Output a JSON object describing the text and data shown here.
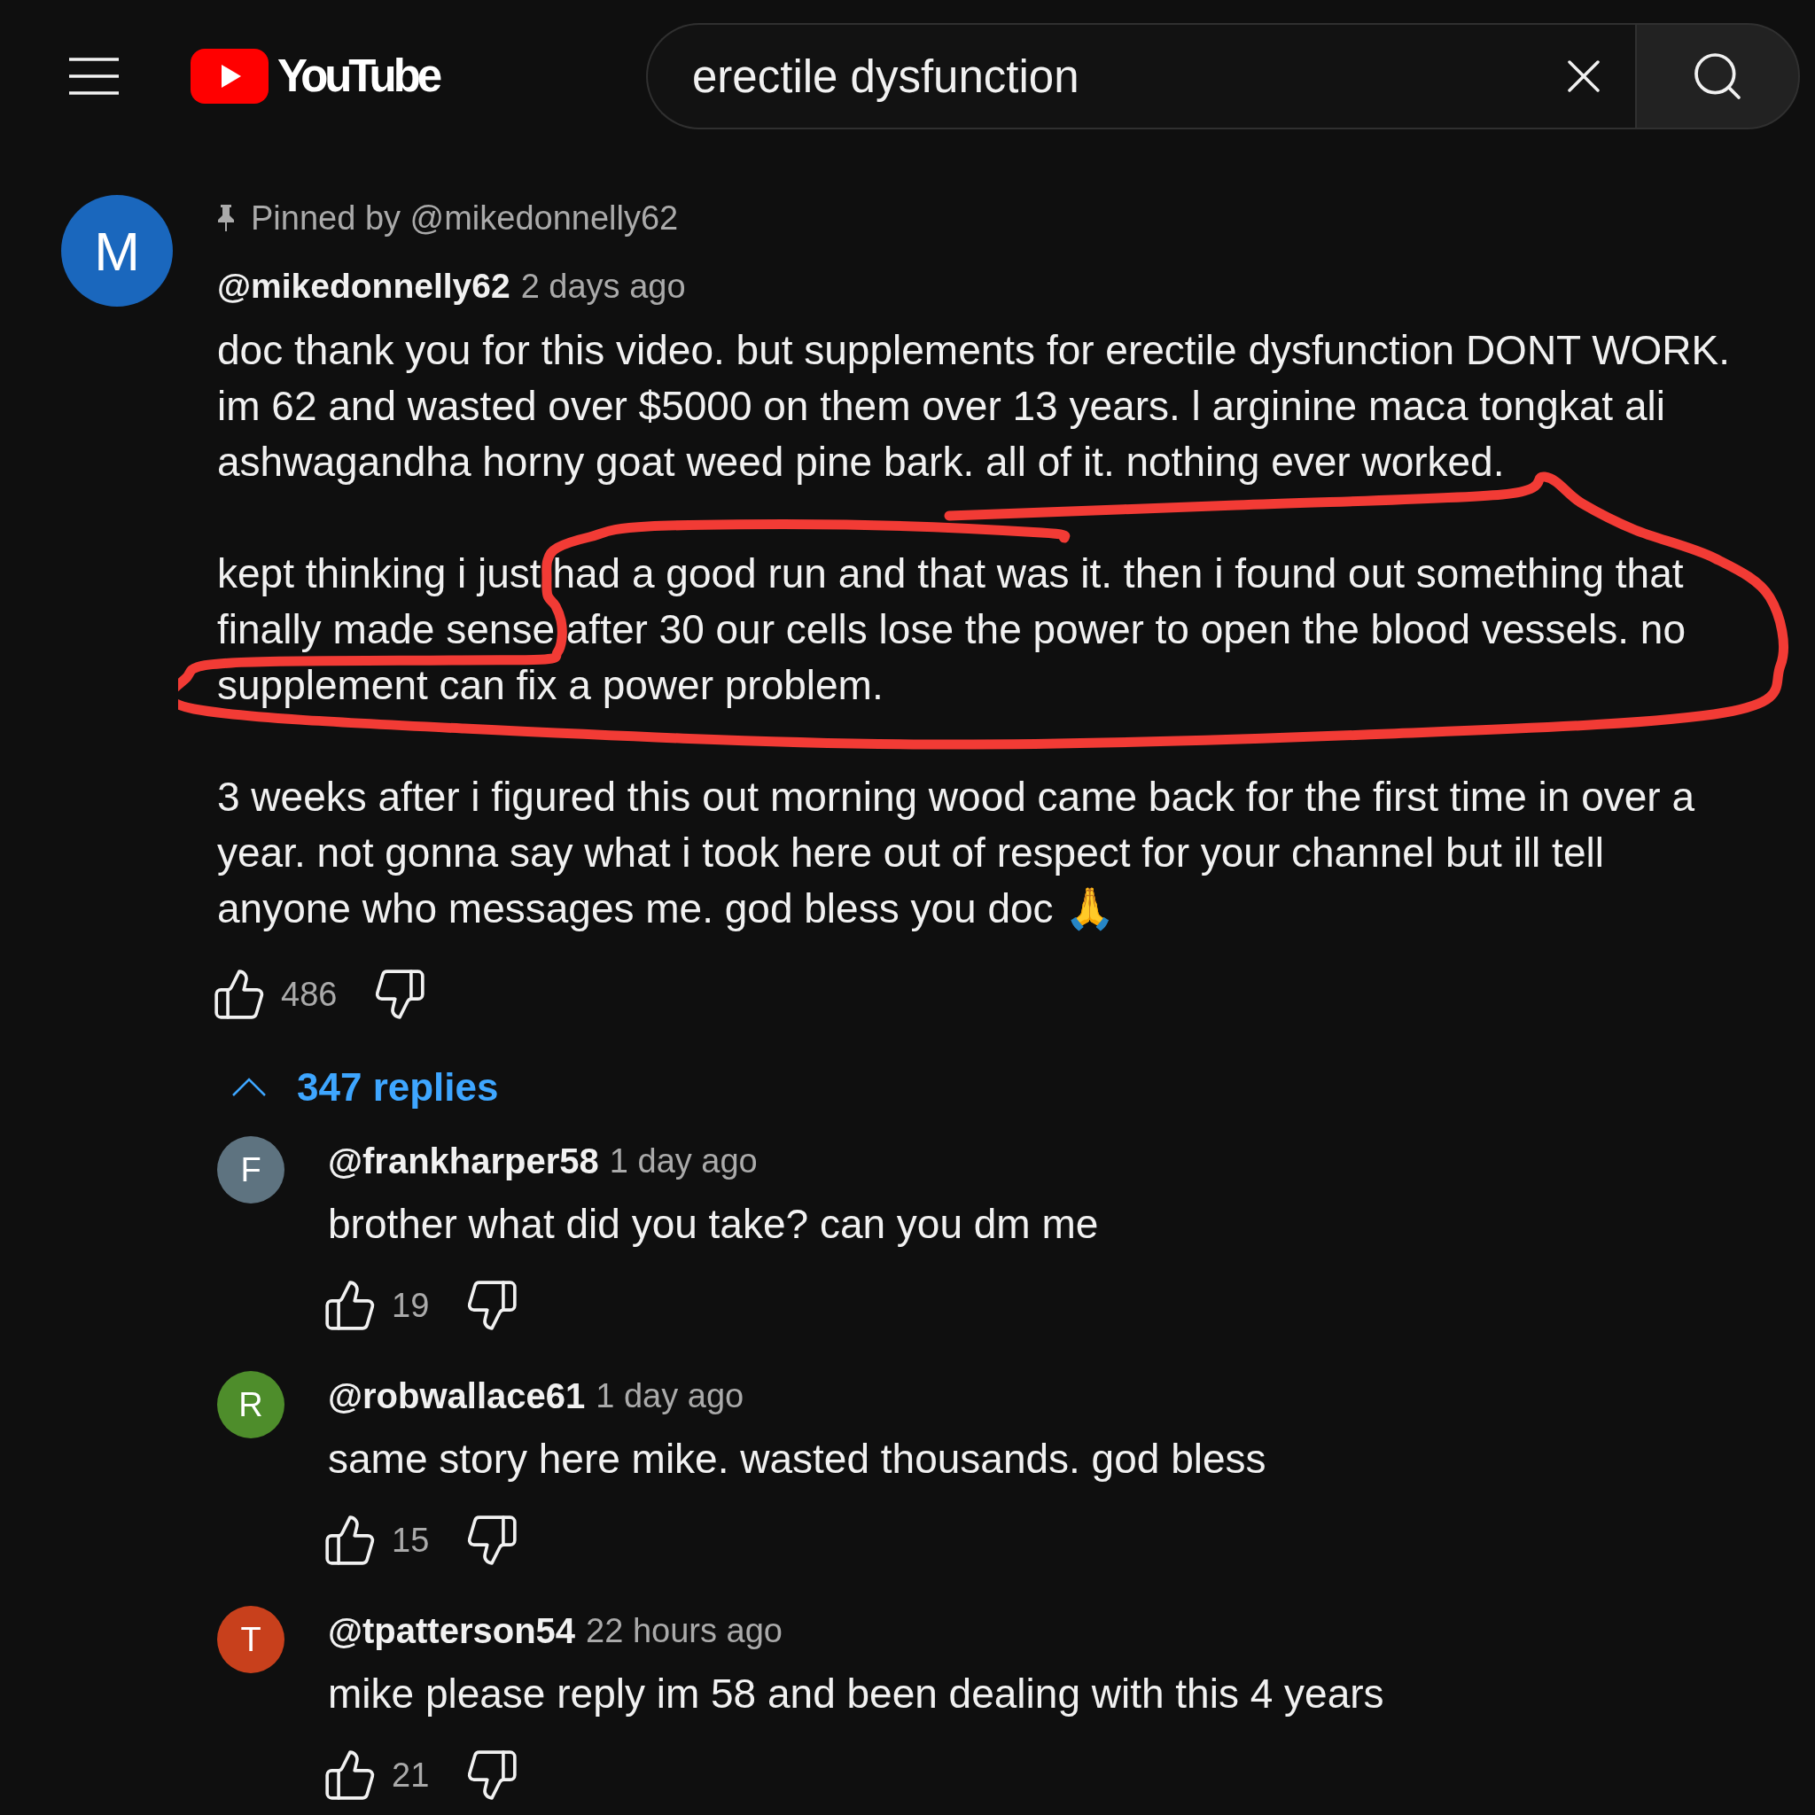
{
  "header": {
    "logo": {
      "text": "YouTube"
    },
    "search": {
      "value": "erectile dysfunction"
    }
  },
  "comment": {
    "pinned_by": "Pinned by @mikedonnelly62",
    "avatar": {
      "letter": "M",
      "color": "#1a67bd"
    },
    "author": "@mikedonnelly62",
    "time": "2 days ago",
    "paragraphs": [
      {
        "text": "doc thank you for this video. but supplements for erectile dysfunction DONT WORK. im 62 and wasted over $5000 on them over 13 years. l arginine maca tongkat ali ashwagandha horny goat weed pine bark. all of it. nothing ever worked.",
        "circled": false
      },
      {
        "text": "kept thinking i just had a good run and that was it. then i found out something that finally made sense after 30 our cells lose the power to open the blood vessels. no supplement can fix a power problem.",
        "circled": true
      },
      {
        "text": "3 weeks after i figured this out morning wood came back for the first time in over a year. not gonna say what i took here out of respect for your channel but ill tell anyone who messages me. god bless you doc 🙏",
        "circled": false
      }
    ],
    "likes": "486"
  },
  "replies_toggle": {
    "label": "347 replies",
    "expanded": true
  },
  "replies": [
    {
      "avatar": {
        "letter": "F",
        "color": "#5e7380"
      },
      "author": "@frankharper58",
      "time": "1 day ago",
      "text": "brother what did you take? can you dm me",
      "likes": "19"
    },
    {
      "avatar": {
        "letter": "R",
        "color": "#4e8d2b"
      },
      "author": "@robwallace61",
      "time": "1 day ago",
      "text": "same story here mike. wasted thousands. god bless",
      "likes": "15"
    },
    {
      "avatar": {
        "letter": "T",
        "color": "#c8401c"
      },
      "author": "@tpatterson54",
      "time": "22 hours ago",
      "text": "mike please reply im 58 and been dealing with this 4 years",
      "likes": "21"
    }
  ]
}
